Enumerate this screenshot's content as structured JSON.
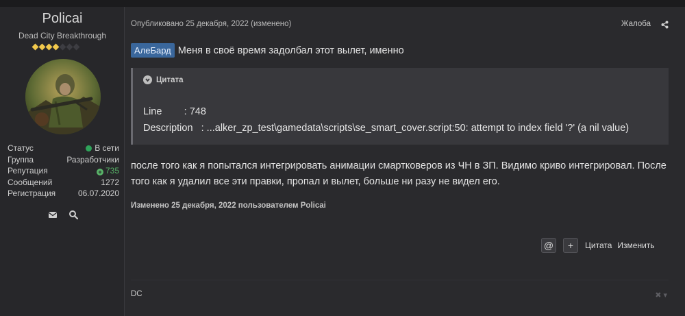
{
  "user": {
    "name": "Policai",
    "title": "Dead City Breakthrough",
    "banner_filled": 4,
    "banner_total": 7,
    "stats": [
      {
        "label": "Статус",
        "value": "В сети"
      },
      {
        "label": "Группа",
        "value": "Разработчики"
      },
      {
        "label": "Репутация",
        "value": "735"
      },
      {
        "label": "Сообщений",
        "value": "1272"
      },
      {
        "label": "Регистрация",
        "value": "06.07.2020"
      }
    ],
    "actions": [
      {
        "icon": "envelope-icon"
      },
      {
        "icon": "search-icon"
      }
    ]
  },
  "post": {
    "meta": "Опубликовано 25 декабря, 2022 (изменено)",
    "report_label": "Жалоба",
    "mention": "АлеБард",
    "line1": "Меня в своё время задолбал этот вылет, именно",
    "quote": {
      "header": "Цитата",
      "line1": "Line        : 748",
      "line2": "Description   : ...alker_zp_test\\gamedata\\scripts\\se_smart_cover.script:50: attempt to index field '?' (a nil value)"
    },
    "paragraph": "после того как я попытался интегрировать анимации смартковеров из ЧН в ЗП. Видимо криво интегрировал. После того как я удалил все эти правки, пропал и вылет, больше ни разу не видел его.",
    "edited_note": "Изменено 25 декабря, 2022 пользователем Policai",
    "actions": {
      "mention_btn": "@",
      "multiquote_btn": "+",
      "quote_label": "Цитата",
      "edit_label": "Изменить"
    },
    "signature": "DC",
    "sig_tools": "✖ ▾"
  },
  "colors": {
    "accent": "#3a679c",
    "online": "#2fa35a",
    "reputation": "#58b368",
    "banner": "#f2c94c"
  }
}
